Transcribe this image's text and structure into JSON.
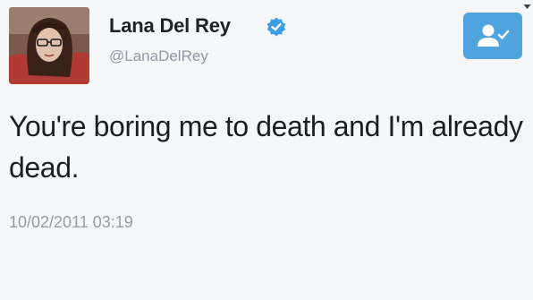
{
  "user": {
    "display_name": "Lana Del Rey",
    "handle": "@LanaDelRey",
    "verified": true,
    "avatar_icon": "profile-photo"
  },
  "tweet": {
    "text": "You're boring me to death and I'm already dead.",
    "timestamp": "10/02/2011 03:19"
  },
  "follow_button": {
    "icon": "add-user-icon",
    "color": "#4fa4dd"
  },
  "colors": {
    "verified_badge": "#3a9ee2",
    "handle": "#8e9aa4",
    "timestamp": "#939ba3"
  }
}
